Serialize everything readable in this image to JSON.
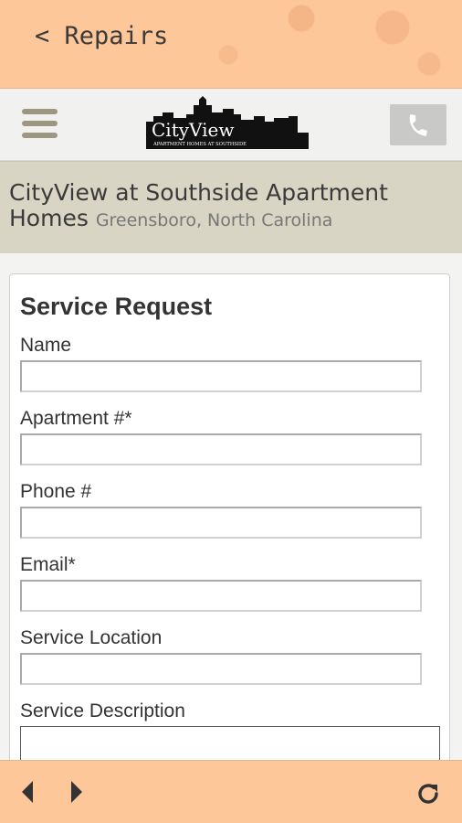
{
  "header": {
    "back_label": "< Repairs"
  },
  "navbar": {
    "menu_icon": "hamburger-menu-icon",
    "logo_title": "CityView",
    "logo_subtitle": "Apartment Homes At Southside",
    "phone_icon": "phone-icon"
  },
  "property": {
    "name": "CityView at Southside Apartment Homes",
    "location": "Greensboro, North Carolina"
  },
  "form": {
    "title": "Service Request",
    "fields": [
      {
        "label": "Name",
        "value": ""
      },
      {
        "label": "Apartment #*",
        "value": ""
      },
      {
        "label": "Phone #",
        "value": ""
      },
      {
        "label": "Email*",
        "value": ""
      },
      {
        "label": "Service Location",
        "value": ""
      },
      {
        "label": "Service Description",
        "value": ""
      }
    ]
  },
  "footer": {
    "back_icon": "triangle-left-icon",
    "forward_icon": "triangle-right-icon",
    "refresh_icon": "refresh-icon"
  },
  "colors": {
    "accent": "#fdc79a",
    "property_band": "#d8d5c4",
    "menu_icon": "#9b9780"
  }
}
